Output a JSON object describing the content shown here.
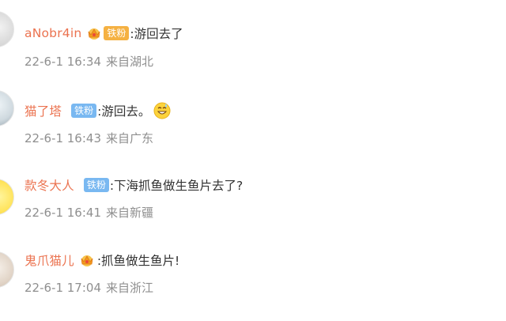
{
  "comments": [
    {
      "username": "aNobr4in",
      "badge": {
        "crown": true,
        "tag": "铁粉",
        "tag_color": "#f5b142"
      },
      "text": ":游回去了",
      "date": "22-6-1 16:34",
      "location": "来自湖北"
    },
    {
      "username": "猫了塔",
      "badge": {
        "crown": false,
        "tag": "铁粉",
        "tag_color": "#79b8f1"
      },
      "text": ":游回去。",
      "emoji": "smiling-sweat-emoji",
      "date": "22-6-1 16:43",
      "location": "来自广东"
    },
    {
      "username": "款冬大人",
      "badge": {
        "crown": false,
        "tag": "铁粉",
        "tag_color": "#79b8f1"
      },
      "text": ":下海抓鱼做生鱼片去了?",
      "date": "22-6-1 16:41",
      "location": "来自新疆"
    },
    {
      "username": "鬼爪猫儿",
      "badge": {
        "crown": true,
        "tag": "",
        "tag_color": "#f5b142"
      },
      "text": ":抓鱼做生鱼片!",
      "date": "22-6-1 17:04",
      "location": "来自浙江"
    }
  ],
  "colors": {
    "username": "#eb7350",
    "content": "#333333",
    "meta": "#8f8f8f"
  }
}
